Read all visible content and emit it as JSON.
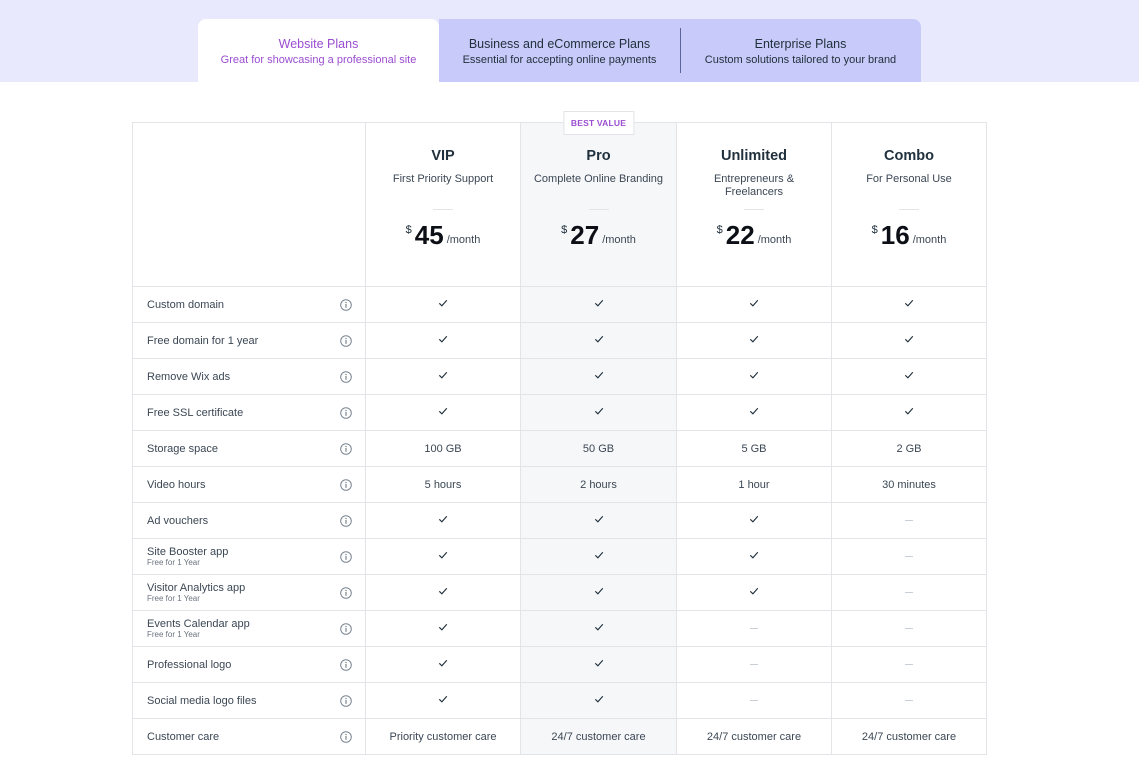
{
  "tabs": [
    {
      "title": "Website Plans",
      "subtitle": "Great for showcasing a professional site"
    },
    {
      "title": "Business and eCommerce Plans",
      "subtitle": "Essential for accepting online payments"
    },
    {
      "title": "Enterprise Plans",
      "subtitle": "Custom solutions tailored to your brand"
    }
  ],
  "colors": {
    "accent": "#9a4dd0",
    "band": "#e8e9fd",
    "inactive_tab": "#c8cbf9"
  },
  "best_value_label": "BEST VALUE",
  "plans": [
    {
      "name": "VIP",
      "subtitle": "First Priority Support",
      "currency": "$",
      "price": "45",
      "period": "/month"
    },
    {
      "name": "Pro",
      "subtitle": "Complete Online Branding",
      "currency": "$",
      "price": "27",
      "period": "/month"
    },
    {
      "name": "Unlimited",
      "subtitle": "Entrepreneurs & Freelancers",
      "currency": "$",
      "price": "22",
      "period": "/month"
    },
    {
      "name": "Combo",
      "subtitle": "For Personal Use",
      "currency": "$",
      "price": "16",
      "period": "/month"
    }
  ],
  "features": [
    {
      "label": "Custom domain",
      "note": "",
      "values": [
        "check",
        "check",
        "check",
        "check"
      ]
    },
    {
      "label": "Free domain for 1 year",
      "note": "",
      "values": [
        "check",
        "check",
        "check",
        "check"
      ]
    },
    {
      "label": "Remove Wix ads",
      "note": "",
      "values": [
        "check",
        "check",
        "check",
        "check"
      ]
    },
    {
      "label": "Free SSL certificate",
      "note": "",
      "values": [
        "check",
        "check",
        "check",
        "check"
      ]
    },
    {
      "label": "Storage space",
      "note": "",
      "values": [
        "100 GB",
        "50 GB",
        "5 GB",
        "2 GB"
      ]
    },
    {
      "label": "Video hours",
      "note": "",
      "values": [
        "5 hours",
        "2 hours",
        "1 hour",
        "30 minutes"
      ]
    },
    {
      "label": "Ad vouchers",
      "note": "",
      "values": [
        "check",
        "check",
        "check",
        "dash"
      ]
    },
    {
      "label": "Site Booster app",
      "note": "Free for 1 Year",
      "values": [
        "check",
        "check",
        "check",
        "dash"
      ]
    },
    {
      "label": "Visitor Analytics app",
      "note": "Free for 1 Year",
      "values": [
        "check",
        "check",
        "check",
        "dash"
      ]
    },
    {
      "label": "Events Calendar app",
      "note": "Free for 1 Year",
      "values": [
        "check",
        "check",
        "dash",
        "dash"
      ]
    },
    {
      "label": "Professional logo",
      "note": "",
      "values": [
        "check",
        "check",
        "dash",
        "dash"
      ]
    },
    {
      "label": "Social media logo files",
      "note": "",
      "values": [
        "check",
        "check",
        "dash",
        "dash"
      ]
    },
    {
      "label": "Customer care",
      "note": "",
      "values": [
        "Priority customer care",
        "24/7 customer care",
        "24/7 customer care",
        "24/7 customer care"
      ]
    }
  ]
}
